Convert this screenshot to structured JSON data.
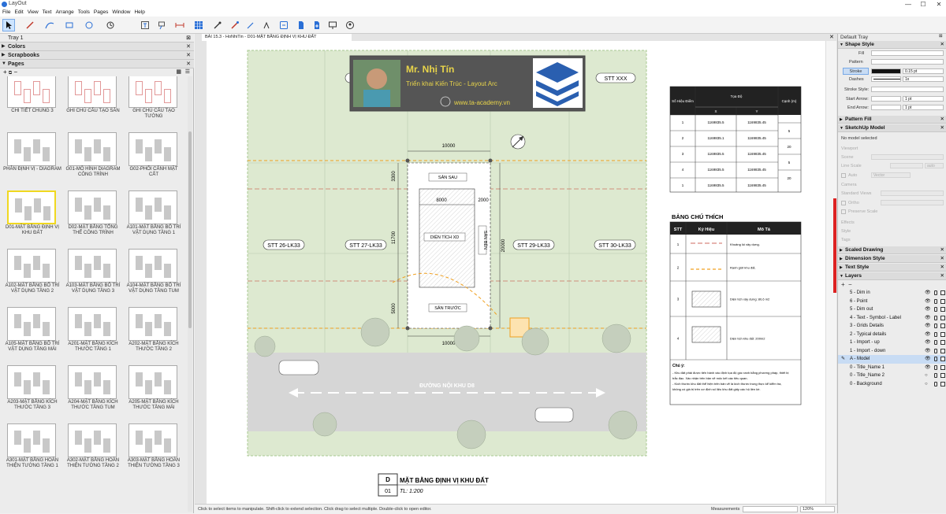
{
  "app": {
    "title": "LayOut",
    "window_buttons": [
      "—",
      "☐",
      "✕"
    ]
  },
  "menu": [
    "File",
    "Edit",
    "View",
    "Text",
    "Arrange",
    "Tools",
    "Pages",
    "Window",
    "Help"
  ],
  "toolbar_icons": [
    "select-arrow-icon",
    "pencil-line-icon",
    "bezier-icon",
    "rectangle-icon",
    "circle-icon",
    "polygon-icon",
    "text-icon",
    "label-icon",
    "dimension-icon",
    "table-icon",
    "eyedropper-icon",
    "paint-icon",
    "eraser-icon",
    "split-icon",
    "sketchup-icon",
    "document-icon",
    "document-add-icon",
    "presentation-icon",
    "user-icon"
  ],
  "left_tray": {
    "title": "Tray 1",
    "panels": [
      "Colors",
      "Scrapbooks",
      "Pages"
    ],
    "pages": [
      {
        "label": "CHI TIẾT CHUNG 3"
      },
      {
        "label": "GHI CHÚ CẤU TẠO SÀN"
      },
      {
        "label": "GHI CHÚ CẤU TẠO TƯỜNG"
      },
      {
        "label": "PHÂN ĐỊNH VỊ - DIAGRAM"
      },
      {
        "label": "G01-MÔ HÌNH DIAGRAM CÔNG TRÌNH"
      },
      {
        "label": "G02-PHỐI CẢNH MẶT CẮT"
      },
      {
        "label": "D01-MẶT BẰNG ĐỊNH VỊ KHU ĐẤT"
      },
      {
        "label": "D02-MẶT BẰNG TỔNG THỂ CÔNG TRÌNH"
      },
      {
        "label": "A101-MẶT BẰNG BỐ TRÍ VẬT DỤNG TẦNG 1"
      },
      {
        "label": "A102-MẶT BẰNG BỐ TRÍ VẬT DỤNG TẦNG 2"
      },
      {
        "label": "A103-MẶT BẰNG BỐ TRÍ VẬT DỤNG TẦNG 3"
      },
      {
        "label": "A104-MẶT BẰNG BỐ TRÍ VẬT DỤNG TẦNG TUM"
      },
      {
        "label": "A105-MẶT BẰNG BỐ TRÍ VẬT DỤNG TẦNG MÁI"
      },
      {
        "label": "A201-MẶT BẰNG KÍCH THƯỚC TẦNG 1"
      },
      {
        "label": "A202-MẶT BẰNG KÍCH THƯỚC TẦNG 2"
      },
      {
        "label": "A203-MẶT BẰNG KÍCH THƯỚC TẦNG 3"
      },
      {
        "label": "A204-MẶT BẰNG KÍCH THƯỚC TẦNG TUM"
      },
      {
        "label": "A205-MẶT BẰNG KÍCH THƯỚC TẦNG MÁI"
      },
      {
        "label": "A301-MẶT BẰNG HOÀN THIỆN TƯỜNG TẦNG 1"
      },
      {
        "label": "A302-MẶT BẰNG HOÀN THIỆN TƯỜNG TẦNG 2"
      },
      {
        "label": "A303-MẶT BẰNG HOÀN THIỆN TƯỜNG TẦNG 3"
      }
    ]
  },
  "doc": {
    "tab": "BÀI 15.3 - HoNhiTin - D01-MẶT BẰNG ĐỊNH VỊ KHU ĐẤT",
    "banner": {
      "name": "Mr. Nhị Tín",
      "subtitle": "Triển khai Kiến Trúc - Layout Arc",
      "url": "www.ta-academy.vn"
    },
    "lots": {
      "top_right": "STT XXX",
      "l26": "STT 26-LK33",
      "l27": "STT 27-LK33",
      "l29": "STT 29-LK33",
      "l30": "STT 30-LK33"
    },
    "dims": {
      "top": "10000",
      "bottom": "10000",
      "inner_w": "8000",
      "inner_r": "2000",
      "left_top": "3300",
      "left_mid": "11700",
      "left_bot": "5000",
      "right": "20000"
    },
    "zones": {
      "back": "SÂN SAU",
      "center": "DIỆN TÍCH XD",
      "side": "SÂN BÊN",
      "front": "SÂN TRƯỚC"
    },
    "road": "ĐƯỜNG NỘI KHU D8",
    "drawing_title": {
      "letter": "D",
      "number": "01",
      "name": "MẶT BẰNG ĐỊNH VỊ KHU ĐẤT",
      "scale": "TL: 1:200"
    },
    "coord_table": {
      "h_point": "Số Hiệu Điểm",
      "h_coord": "Tọa Độ",
      "h_x": "X",
      "h_y": "Y",
      "h_edge": "Cạnh (m)",
      "rows": [
        {
          "n": "1",
          "x": "1169835.5",
          "y": "1169835.45"
        },
        {
          "n": "2",
          "x": "1169835.1",
          "y": "1169835.45"
        },
        {
          "n": "3",
          "x": "1169835.5",
          "y": "1169835.45"
        },
        {
          "n": "4",
          "x": "1169835.5",
          "y": "1169835.45"
        },
        {
          "n": "1",
          "x": "1169835.5",
          "y": "1169835.45"
        }
      ],
      "edges": [
        "5",
        "20",
        "5",
        "20"
      ]
    },
    "legend": {
      "title": "BẢNG CHÚ THÍCH",
      "h_stt": "STT",
      "h_sym": "Ký Hiệu",
      "h_desc": "Mô Tả",
      "rows": [
        {
          "n": "1",
          "desc": "Khoảng lùi xây dựng."
        },
        {
          "n": "2",
          "desc": "Ranh giới khu đất."
        },
        {
          "n": "3",
          "desc": "Diện tích xây dựng: 80,6 m2"
        },
        {
          "n": "4",
          "desc": "Diện tích khu đất: 200m2"
        }
      ],
      "note_title": "Chú ý:",
      "notes": [
        "- Khu đất phải được tiến hành xác định tọa độ góc ranh bằng phương pháp, thiết bị",
        "trắc đạc. Xác nhận trên bản vẽ mốc kết các tiêu quan.",
        "- Kích thước khu đất thể hiện trên bản vẽ là kích thước trung thực kể kiểm tra,",
        "không có giá trị trên cơ định số liệu khu đất giấy các hộ liền kề."
      ]
    }
  },
  "status": {
    "hint": "Click to select items to manipulate. Shift-click to extend selection. Click drag to select multiple. Double-click to open editor.",
    "measurements_label": "Measurements",
    "zoom": "120%"
  },
  "right_tray": {
    "title": "Default Tray",
    "shape_style": {
      "header": "Shape Style",
      "fill": "Fill",
      "pattern": "Pattern",
      "stroke": "Stroke",
      "stroke_value": "0.15 pt",
      "dashes": "Dashes",
      "dash_scale": "1x",
      "stroke_style": "Stroke Style:",
      "start_arrow": "Start Arrow:",
      "end_arrow": "End Arrow:",
      "start_size": "1 pt",
      "end_size": "1 pt"
    },
    "pattern_fill": "Pattern Fill",
    "sketchup_model": {
      "header": "SketchUp Model",
      "status": "No model selected",
      "viewport": "Viewport",
      "scene": "Scene",
      "line_scale": "Line Scale",
      "auto": "auto",
      "auto_check": "Auto",
      "render": "Vector",
      "camera": "Camera",
      "standard_views": "Standard Views",
      "ortho": "Ortho",
      "preserve_scale": "Preserve Scale",
      "effects": "Effects",
      "style": "Style",
      "tags": "Tags"
    },
    "sections": [
      "Scaled Drawing",
      "Dimension Style",
      "Text Style",
      "Layers"
    ],
    "layers": [
      {
        "name": "5 - Dim in"
      },
      {
        "name": "6 - Point"
      },
      {
        "name": "5 - Dim out"
      },
      {
        "name": "4 - Text - Symbol - Label"
      },
      {
        "name": "3 - Grids Details"
      },
      {
        "name": "2 - Typical details"
      },
      {
        "name": "1 - Import - up"
      },
      {
        "name": "1 - Import - down"
      },
      {
        "name": "A - Model",
        "selected": true
      },
      {
        "name": "0 - Title_Name 1"
      },
      {
        "name": "0 - Title_Name 2"
      },
      {
        "name": "0 - Background"
      }
    ]
  },
  "colors": {
    "site_green": "#dde9d0",
    "road": "#d6d6d6",
    "orange": "#f0a020",
    "red": "#c0392b",
    "accent": "#2a6fd6"
  }
}
